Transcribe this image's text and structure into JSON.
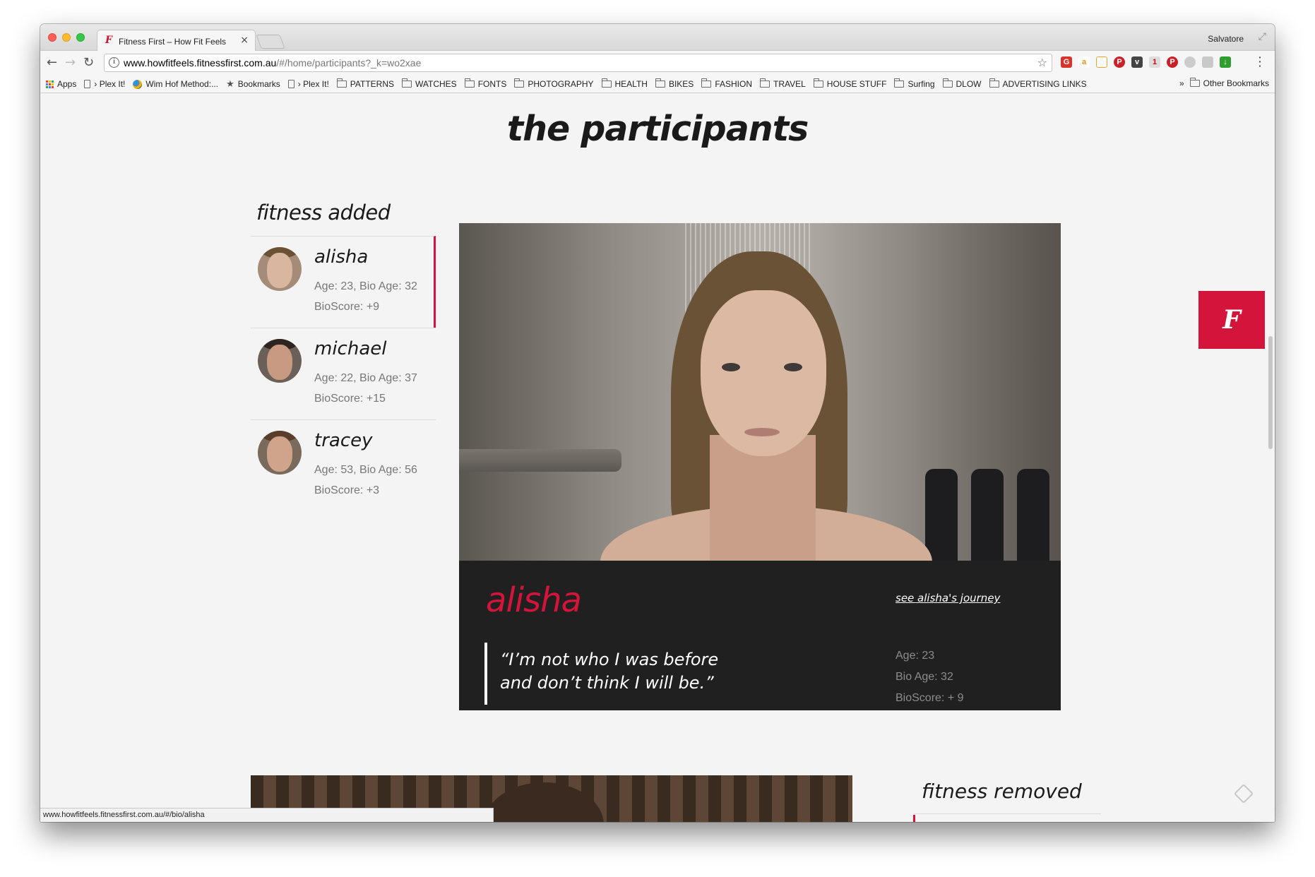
{
  "browser": {
    "tab_title": "Fitness First – How Fit Feels",
    "tab_favicon": "F",
    "profile_name": "Salvatore",
    "url_host": "www.howfitfeels.fitnessfirst.com.au",
    "url_path": "/#/home/participants?_k=wo2xae",
    "status_url": "www.howfitfeels.fitnessfirst.com.au/#/bio/alisha"
  },
  "bookmarks": {
    "items": [
      {
        "label": "Apps",
        "icon": "apps-icon"
      },
      {
        "label": "› Plex It!",
        "icon": "page-icon"
      },
      {
        "label": "Wim Hof Method:...",
        "icon": "wim-hof-icon"
      },
      {
        "label": "Bookmarks",
        "icon": "star-icon"
      },
      {
        "label": "› Plex It!",
        "icon": "page-icon"
      },
      {
        "label": "PATTERNS",
        "icon": "folder-icon"
      },
      {
        "label": "WATCHES",
        "icon": "folder-icon"
      },
      {
        "label": "FONTS",
        "icon": "folder-icon"
      },
      {
        "label": "PHOTOGRAPHY",
        "icon": "folder-icon"
      },
      {
        "label": "HEALTH",
        "icon": "folder-icon"
      },
      {
        "label": "BIKES",
        "icon": "folder-icon"
      },
      {
        "label": "FASHION",
        "icon": "folder-icon"
      },
      {
        "label": "TRAVEL",
        "icon": "folder-icon"
      },
      {
        "label": "HOUSE STUFF",
        "icon": "folder-icon"
      },
      {
        "label": "Surfing",
        "icon": "folder-icon"
      },
      {
        "label": "DLOW",
        "icon": "folder-icon"
      },
      {
        "label": "ADVERTISING LINKS",
        "icon": "folder-icon"
      }
    ],
    "overflow": "»",
    "other": "Other Bookmarks"
  },
  "page": {
    "heading": "the participants",
    "fitness_added_title": "fitness added",
    "fitness_removed_title": "fitness removed",
    "participants": [
      {
        "name": "alisha",
        "age_line": "Age: 23, Bio Age: 32",
        "score_line": "BioScore: +9",
        "active": true
      },
      {
        "name": "michael",
        "age_line": "Age: 22, Bio Age: 37",
        "score_line": "BioScore: +15",
        "active": false
      },
      {
        "name": "tracey",
        "age_line": "Age: 53, Bio Age: 56",
        "score_line": "BioScore: +3",
        "active": false
      }
    ],
    "feature": {
      "name": "alisha",
      "journey_link": "see alisha's journey",
      "quote_line1": "“I’m not who I was before",
      "quote_line2": "and don’t think I will be.”",
      "age": "Age: 23",
      "bio_age": "Bio Age: 32",
      "bio_score": "BioScore: + 9"
    },
    "brand_logo": "F"
  },
  "colors": {
    "accent": "#d4143a",
    "panel": "#202020",
    "page_bg": "#f4f4f4"
  }
}
